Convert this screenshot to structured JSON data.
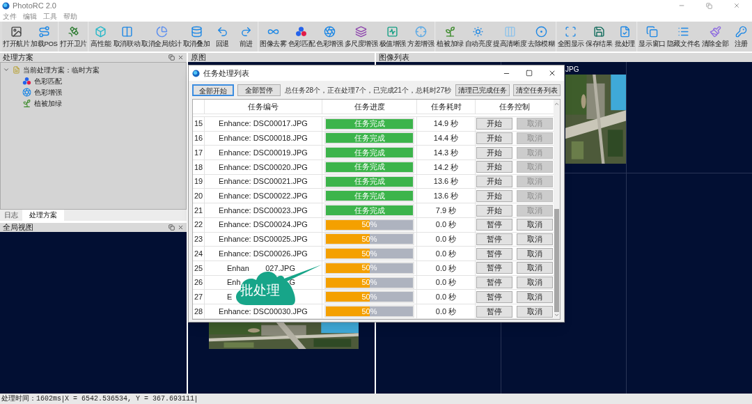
{
  "app": {
    "title": "PhotoRC 2.0"
  },
  "menu": [
    "文件",
    "编辑",
    "工具",
    "帮助"
  ],
  "toolbar": [
    [
      "打开航片",
      "加载POS"
    ],
    [
      "打开卫片"
    ],
    [
      "高性能",
      "取消联动",
      "取消全局统计",
      "取消叠加",
      "回退",
      "前进"
    ],
    [
      "图像去雾",
      "色彩匹配",
      "色彩增强",
      "多尺度增强",
      "极值增强",
      "方差增强"
    ],
    [
      "植被加绿",
      "自动亮度",
      "提高清晰度",
      "去除模糊"
    ],
    [
      "全图显示",
      "保存结果",
      "批处理"
    ],
    [
      "显示窗口",
      "隐藏文件名",
      "清除全部",
      "注册"
    ]
  ],
  "scheme_panel": {
    "title": "处理方案",
    "tree": {
      "label": "当前处理方案：临时方案",
      "expanded": true,
      "children": [
        "色彩匹配",
        "色彩增强",
        "植被加绿"
      ]
    }
  },
  "left_tabs": [
    {
      "label": "日志",
      "selected": false
    },
    {
      "label": "处理方案",
      "selected": true
    }
  ],
  "overview_panel": {
    "title": "全局视图"
  },
  "original_panel": {
    "title": "原图"
  },
  "image_list_panel": {
    "title": "图像列表",
    "caption": "JPG"
  },
  "dialog": {
    "title": "任务处理列表",
    "left_buttons": [
      {
        "label": "全部开始",
        "focused": true
      },
      {
        "label": "全部暂停",
        "focused": false
      }
    ],
    "summary": "总任务28个，正在处理7个，已完成21个，总耗时27秒",
    "right_buttons": [
      "清理已完成任务",
      "清空任务列表"
    ],
    "columns": [
      "任务编号",
      "任务进度",
      "任务耗时",
      "任务控制"
    ],
    "rows": [
      {
        "index": "15",
        "file": "Enhance: DSC00017.JPG",
        "kind": "done",
        "level": 1,
        "progress": "任务完成",
        "time": "14.9 秒",
        "action": "开始",
        "cancel": "取消",
        "cancel_disabled": true
      },
      {
        "index": "16",
        "file": "Enhance: DSC00018.JPG",
        "kind": "done",
        "level": 1,
        "progress": "任务完成",
        "time": "14.4 秒",
        "action": "开始",
        "cancel": "取消",
        "cancel_disabled": true
      },
      {
        "index": "17",
        "file": "Enhance: DSC00019.JPG",
        "kind": "done",
        "level": 1,
        "progress": "任务完成",
        "time": "14.3 秒",
        "action": "开始",
        "cancel": "取消",
        "cancel_disabled": true
      },
      {
        "index": "18",
        "file": "Enhance: DSC00020.JPG",
        "kind": "done",
        "level": 1,
        "progress": "任务完成",
        "time": "14.2 秒",
        "action": "开始",
        "cancel": "取消",
        "cancel_disabled": true
      },
      {
        "index": "19",
        "file": "Enhance: DSC00021.JPG",
        "kind": "done",
        "level": 1,
        "progress": "任务完成",
        "time": "13.6 秒",
        "action": "开始",
        "cancel": "取消",
        "cancel_disabled": true
      },
      {
        "index": "20",
        "file": "Enhance: DSC00022.JPG",
        "kind": "done",
        "level": 1,
        "progress": "任务完成",
        "time": "13.6 秒",
        "action": "开始",
        "cancel": "取消",
        "cancel_disabled": true
      },
      {
        "index": "21",
        "file": "Enhance: DSC00023.JPG",
        "kind": "done",
        "level": 1,
        "progress": "任务完成",
        "time": "7.9 秒",
        "action": "开始",
        "cancel": "取消",
        "cancel_disabled": true
      },
      {
        "index": "22",
        "file": "Enhance: DSC00024.JPG",
        "kind": "running",
        "level": 0.5,
        "progress": "50%",
        "time": "0.0 秒",
        "action": "暂停",
        "cancel": "取消",
        "cancel_disabled": false
      },
      {
        "index": "23",
        "file": "Enhance: DSC00025.JPG",
        "kind": "running",
        "level": 0.5,
        "progress": "50%",
        "time": "0.0 秒",
        "action": "暂停",
        "cancel": "取消",
        "cancel_disabled": false
      },
      {
        "index": "24",
        "file": "Enhance: DSC00026.JPG",
        "kind": "running",
        "level": 0.5,
        "progress": "50%",
        "time": "0.0 秒",
        "action": "暂停",
        "cancel": "取消",
        "cancel_disabled": false
      },
      {
        "index": "25",
        "file": "Enhan",
        "file_tail": "027.JPG",
        "kind": "running",
        "level": 0.5,
        "progress": "50%",
        "time": "0.0 秒",
        "action": "暂停",
        "cancel": "取消",
        "cancel_disabled": false
      },
      {
        "index": "26",
        "file": "Enh",
        "file_tail": "G",
        "kind": "running",
        "level": 0.5,
        "progress": "50%",
        "time": "0.0 秒",
        "action": "暂停",
        "cancel": "取消",
        "cancel_disabled": false
      },
      {
        "index": "27",
        "file": "E",
        "kind": "running",
        "level": 0.5,
        "progress": "50%",
        "time": "0.0 秒",
        "action": "暂停",
        "cancel": "取消",
        "cancel_disabled": false
      },
      {
        "index": "28",
        "file": "Enhance: DSC00030.JPG",
        "kind": "running",
        "level": 0.5,
        "progress": "50%",
        "time": "0.0 秒",
        "action": "暂停",
        "cancel": "取消",
        "cancel_disabled": false
      }
    ]
  },
  "callout": {
    "text": "批处理"
  },
  "status_bar": [
    "处理时间：1602ms",
    "X = 6542.536534, Y = 367.693111"
  ]
}
